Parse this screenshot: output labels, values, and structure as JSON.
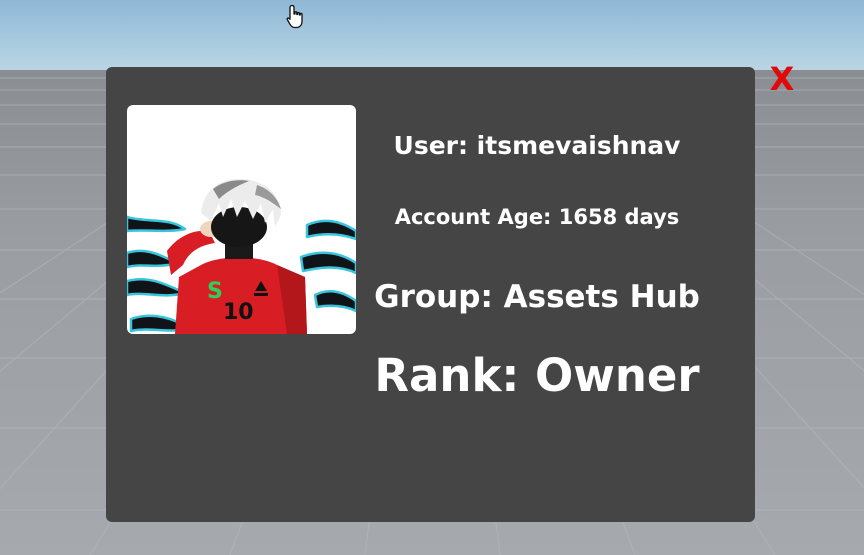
{
  "profile_panel": {
    "user_text": "User: itsmevaishnav",
    "account_age_text": "Account Age: 1658 days",
    "group_text": "Group: Assets Hub",
    "rank_text": "Rank: Owner",
    "close_label": "X",
    "avatar_jersey_number": "10",
    "avatar_jersey_letter": "S"
  },
  "colors": {
    "panel_background": "#454545",
    "text": "#ffffff",
    "close_button": "#e00a0a",
    "sky": "#a9cbe0",
    "ground": "#9a9da2"
  },
  "icons": {
    "cursor": "hand-pointer-icon",
    "close": "close-icon"
  }
}
